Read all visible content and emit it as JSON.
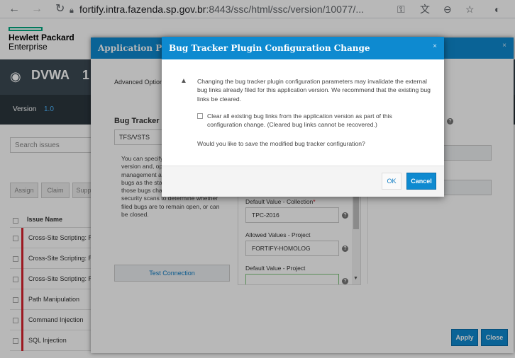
{
  "browser": {
    "url_host": "fortify.intra.fazenda.sp.gov.br",
    "url_rest": ":8443/ssc/html/ssc/version/10077/..."
  },
  "app": {
    "brand_line1": "Hewlett Packard",
    "brand_line2": "Enterprise",
    "project_name": "DVWA",
    "project_suffix": "1",
    "version_label": "Version",
    "version_value": "1.0",
    "search_placeholder": "Search issues",
    "buttons": [
      "Assign",
      "Claim",
      "Supp"
    ],
    "issue_column": "Issue Name",
    "issues": [
      "Cross-Site Scripting: Re",
      "Cross-Site Scripting: Re",
      "Cross-Site Scripting: Re",
      "Path Manipulation",
      "Command Injection",
      "SQL Injection"
    ]
  },
  "bg_dialog": {
    "title": "Application Profi",
    "advanced_options": "Advanced Options",
    "bug_tracker_heading": "Bug Tracker Int",
    "plugin_value": "TFS/VSTS",
    "description": "You can specify to use to submit version and, op state managem management a specific updates to bugs as the states of the issues within those bugs change. SSC checks new security scans to determine whether filed bugs are to remain open, or can be closed.",
    "test_connection": "Test Connection",
    "fields": [
      {
        "label": "Default Value - Collection",
        "required": "*",
        "value": "TPC-2016"
      },
      {
        "label": "Allowed Values - Project",
        "required": "",
        "value": "FORTIFY-HOMOLOG"
      },
      {
        "label": "Default Value - Project",
        "required": "",
        "value": ""
      }
    ],
    "apply": "Apply",
    "close": "Close"
  },
  "modal": {
    "title": "Bug Tracker Plugin Configuration Change",
    "close_glyph": "×",
    "warning": "Changing the bug tracker plugin configuration parameters may invalidate the external bug links already filed for this application version. We recommend that the existing bug links be cleared.",
    "clear_option": "Clear all existing bug links from the application version as part of this configuration change. (Cleared bug links cannot be recovered.)",
    "question": "Would you like to save the modified bug tracker configuration?",
    "ok": "OK",
    "cancel": "Cancel"
  },
  "colors": {
    "accent": "#0e8ad0",
    "dark_bar": "#3c4a54",
    "severity": "#d9232e"
  }
}
